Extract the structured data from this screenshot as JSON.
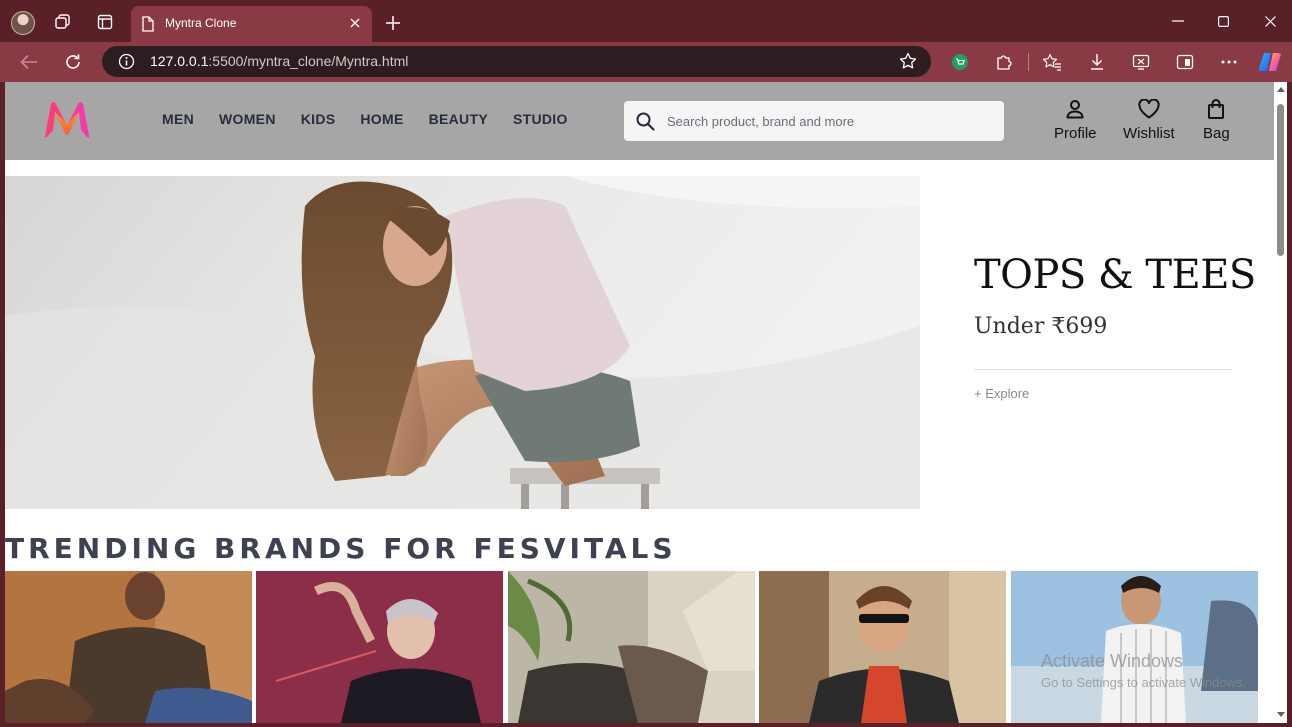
{
  "browser": {
    "tab_title": "Myntra Clone",
    "url_host": "127.0.0.1",
    "url_rest": ":5500/myntra_clone/Myntra.html"
  },
  "icons": {
    "back": "back-arrow-icon",
    "reload": "reload-icon",
    "info": "info-icon",
    "favorite": "star-icon",
    "extensions": "puzzle-icon",
    "collections": "favorites-icon",
    "downloads": "download-icon",
    "screenshot": "screenshot-icon",
    "split": "split-screen-icon",
    "more": "more-icon",
    "copilot": "copilot-icon"
  },
  "colors": {
    "chrome": "#5a2028",
    "toolbar": "#8a3a45",
    "header": "#a6a6a6",
    "nav_text": "#282c3f"
  },
  "header": {
    "nav": [
      "MEN",
      "WOMEN",
      "KIDS",
      "HOME",
      "BEAUTY",
      "STUDIO"
    ],
    "search_placeholder": "Search product, brand and more",
    "actions": {
      "profile": "Profile",
      "wishlist": "Wishlist",
      "bag": "Bag"
    }
  },
  "hero": {
    "title": "TOPS & TEES",
    "subtitle": "Under ₹699",
    "cta": "+ Explore"
  },
  "trending": {
    "title": "TRENDING BRANDS FOR FESVITALS"
  },
  "watermark": {
    "title": "Activate Windows",
    "subtitle": "Go to Settings to activate Windows."
  }
}
